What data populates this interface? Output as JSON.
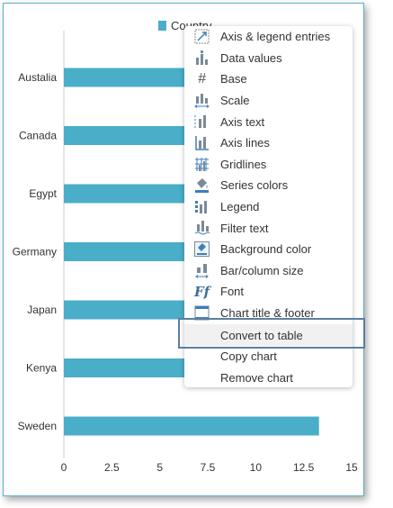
{
  "chart_data": {
    "type": "bar",
    "orientation": "horizontal",
    "categories": [
      "Austalia",
      "Canada",
      "Egypt",
      "Germany",
      "Japan",
      "Kenya",
      "Sweden"
    ],
    "series": [
      {
        "name": "Country",
        "values": [
          13.0,
          12.0,
          12.5,
          11.5,
          13.0,
          12.0,
          13.3
        ]
      }
    ],
    "xlim": [
      0,
      15
    ],
    "xticks": [
      "0",
      "2.5",
      "5",
      "7.5",
      "10",
      "12.5",
      "15"
    ],
    "title": "",
    "xlabel": "",
    "ylabel": "",
    "grid": false,
    "legend_position": "top",
    "bar_color": "#4aaec8"
  },
  "context_menu": {
    "items": [
      {
        "label": "Axis & legend entries",
        "icon": "axis-legend-entries-icon"
      },
      {
        "label": "Data values",
        "icon": "data-values-icon"
      },
      {
        "label": "Base",
        "icon": "base-icon"
      },
      {
        "label": "Scale",
        "icon": "scale-icon"
      },
      {
        "label": "Axis text",
        "icon": "axis-text-icon"
      },
      {
        "label": "Axis lines",
        "icon": "axis-lines-icon"
      },
      {
        "label": "Gridlines",
        "icon": "gridlines-icon"
      },
      {
        "label": "Series colors",
        "icon": "series-colors-icon"
      },
      {
        "label": "Legend",
        "icon": "legend-icon"
      },
      {
        "label": "Filter text",
        "icon": "filter-text-icon"
      },
      {
        "label": "Background color",
        "icon": "background-color-icon"
      },
      {
        "label": "Bar/column size",
        "icon": "bar-column-size-icon"
      },
      {
        "label": "Font",
        "icon": "font-icon"
      },
      {
        "label": "Chart title & footer",
        "icon": "chart-title-footer-icon"
      },
      {
        "label": "Convert to table",
        "icon": ""
      },
      {
        "label": "Copy chart",
        "icon": ""
      },
      {
        "label": "Remove chart",
        "icon": ""
      }
    ],
    "highlighted_label": "Convert to table"
  }
}
